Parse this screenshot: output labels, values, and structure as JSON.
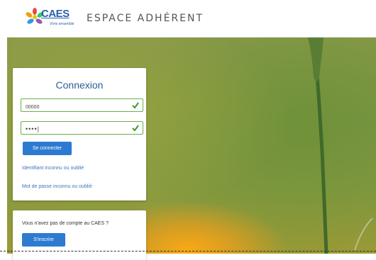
{
  "header": {
    "logo_text": "CAES",
    "logo_sub": "Vivre ensemble",
    "title": "ESPACE ADHÉRENT"
  },
  "login": {
    "title": "Connexion",
    "username_value": "00000",
    "password_value": "••••|",
    "submit_label": "Se connecter",
    "forgot_id_link": "Identifiant inconnu ou oublié",
    "forgot_password_link": "Mot de passe inconnu ou oublié"
  },
  "signup": {
    "prompt": "Vous n'avez pas de compte au CAES ?",
    "button_label": "S'inscrire"
  },
  "colors": {
    "accent": "#2d7bd1",
    "title": "#2b5f96",
    "valid": "#6ab04c",
    "link": "#3a76bb"
  },
  "icons": [
    "caes-logo-icon",
    "check-icon"
  ]
}
